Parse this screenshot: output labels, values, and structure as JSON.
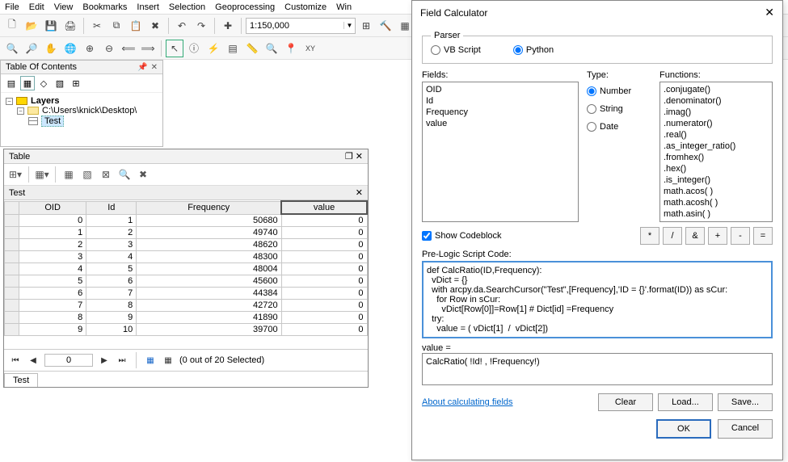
{
  "menu": [
    "File",
    "Edit",
    "View",
    "Bookmarks",
    "Insert",
    "Selection",
    "Geoprocessing",
    "Customize",
    "Win"
  ],
  "scale": "1:150,000",
  "toc": {
    "title": "Table Of Contents",
    "root": "Layers",
    "path": "C:\\Users\\knick\\Desktop\\",
    "leaf": "Test"
  },
  "table": {
    "title": "Table",
    "tab": "Test",
    "columns": [
      "",
      "OID",
      "Id",
      "Frequency",
      "value"
    ],
    "rows": [
      [
        "",
        0,
        1,
        50680,
        0
      ],
      [
        "",
        1,
        2,
        49740,
        0
      ],
      [
        "",
        2,
        3,
        48620,
        0
      ],
      [
        "",
        3,
        4,
        48300,
        0
      ],
      [
        "",
        4,
        5,
        48004,
        0
      ],
      [
        "",
        5,
        6,
        45600,
        0
      ],
      [
        "",
        6,
        7,
        44384,
        0
      ],
      [
        "",
        7,
        8,
        42720,
        0
      ],
      [
        "",
        8,
        9,
        41890,
        0
      ],
      [
        "",
        9,
        10,
        39700,
        0
      ]
    ],
    "nav_pos": "0",
    "nav_status": "(0 out of 20 Selected)",
    "bottom_tab": "Test"
  },
  "fc": {
    "title": "Field Calculator",
    "parser": {
      "legend": "Parser",
      "vb": "VB Script",
      "py": "Python"
    },
    "labels": {
      "fields": "Fields:",
      "type": "Type:",
      "functions": "Functions:",
      "number": "Number",
      "string": "String",
      "date": "Date",
      "show_cb": "Show Codeblock",
      "prelogic": "Pre-Logic Script Code:",
      "expr_label": "value =",
      "about": "About calculating fields",
      "clear": "Clear",
      "load": "Load...",
      "save": "Save...",
      "ok": "OK",
      "cancel": "Cancel"
    },
    "fields_list": [
      "OID",
      "Id",
      "Frequency",
      "value"
    ],
    "funcs_list": [
      ".conjugate()",
      ".denominator()",
      ".imag()",
      ".numerator()",
      ".real()",
      ".as_integer_ratio()",
      ".fromhex()",
      ".hex()",
      ".is_integer()",
      "math.acos( )",
      "math.acosh( )",
      "math.asin( )"
    ],
    "ops": [
      "*",
      "/",
      "&",
      "+",
      "-",
      "="
    ],
    "code": "def CalcRatio(ID,Frequency):\n  vDict = {}\n  with arcpy.da.SearchCursor(\"Test\",[Frequency],'ID = {}'.format(ID)) as sCur:\n    for Row in sCur:\n      vDict[Row[0]]=Row[1] # Dict[id] =Frequency\n  try:\n    value = ( vDict[1]  /  vDict[2])",
    "expr": "CalcRatio( !Id! , !Frequency!)"
  }
}
